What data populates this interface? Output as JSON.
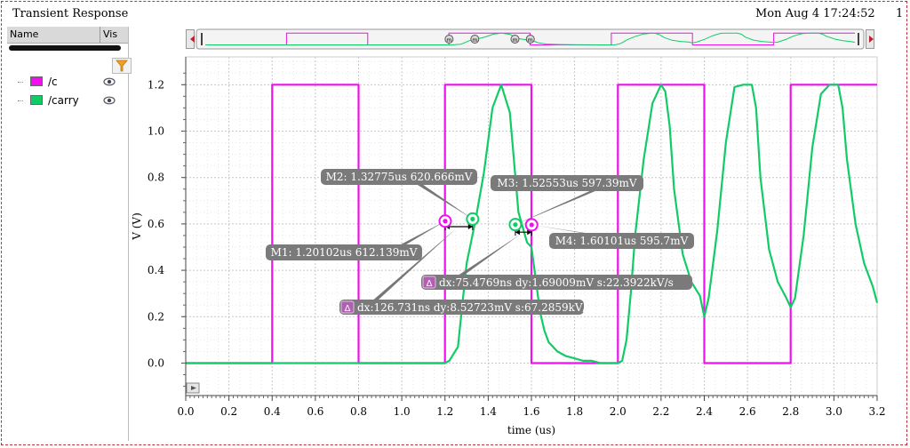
{
  "header": {
    "title": "Transient Response",
    "date": "Mon Aug 4 17:24:52",
    "page": "1"
  },
  "panel": {
    "col_name": "Name",
    "col_vis": "Vis"
  },
  "signals": [
    {
      "name": "/c",
      "color": "#ee11ee",
      "icon": "eye-icon"
    },
    {
      "name": "/carry",
      "color": "#11cc66",
      "icon": "eye-icon"
    }
  ],
  "chart_data": {
    "type": "line",
    "xlabel": "time (us)",
    "ylabel": "V (V)",
    "xlim": [
      0,
      3.2
    ],
    "ylim": [
      -0.14,
      1.32
    ],
    "xticks": [
      "0.0",
      "0.2",
      "0.4",
      "0.6",
      "0.8",
      "1.0",
      "1.2",
      "1.4",
      "1.6",
      "1.8",
      "2.0",
      "2.2",
      "2.4",
      "2.6",
      "2.8",
      "3.0",
      "3.2"
    ],
    "yticks": [
      "0.0",
      "0.2",
      "0.4",
      "0.6",
      "0.8",
      "1.0",
      "1.2"
    ],
    "grid": true,
    "series": [
      {
        "name": "/c",
        "color": "#ee11ee",
        "x": [
          0,
          0.4,
          0.4,
          0.8,
          0.8,
          1.2,
          1.2,
          1.6,
          1.6,
          2.0,
          2.0,
          2.4,
          2.4,
          2.8,
          2.8,
          3.2
        ],
        "y": [
          0,
          0,
          1.2,
          1.2,
          0,
          0,
          1.2,
          1.2,
          0,
          0,
          1.2,
          1.2,
          0,
          0,
          1.2,
          1.2
        ]
      },
      {
        "name": "/carry",
        "color": "#11cc66",
        "x": [
          0,
          1.2,
          1.22,
          1.26,
          1.3,
          1.34,
          1.38,
          1.42,
          1.46,
          1.5,
          1.54,
          1.58,
          1.6,
          1.62,
          1.64,
          1.66,
          1.68,
          1.72,
          1.76,
          1.8,
          1.84,
          1.88,
          1.92,
          1.96,
          2.0,
          2.02,
          2.04,
          2.06,
          2.08,
          2.12,
          2.16,
          2.2,
          2.22,
          2.24,
          2.26,
          2.3,
          2.34,
          2.38,
          2.4,
          2.42,
          2.46,
          2.5,
          2.54,
          2.58,
          2.62,
          2.64,
          2.66,
          2.7,
          2.74,
          2.78,
          2.8,
          2.82,
          2.86,
          2.9,
          2.94,
          2.98,
          3.02,
          3.04,
          3.06,
          3.1,
          3.14,
          3.18,
          3.2
        ],
        "y": [
          0,
          0,
          0.01,
          0.07,
          0.43,
          0.61,
          0.82,
          1.1,
          1.2,
          1.08,
          0.65,
          0.52,
          0.5,
          0.36,
          0.22,
          0.14,
          0.09,
          0.05,
          0.03,
          0.02,
          0.01,
          0.01,
          0.0,
          0.0,
          0.0,
          0.01,
          0.1,
          0.3,
          0.55,
          0.88,
          1.12,
          1.2,
          1.17,
          1.02,
          0.75,
          0.47,
          0.35,
          0.29,
          0.2,
          0.28,
          0.57,
          0.95,
          1.19,
          1.2,
          1.2,
          1.1,
          0.8,
          0.49,
          0.35,
          0.28,
          0.24,
          0.28,
          0.55,
          0.93,
          1.16,
          1.2,
          1.2,
          1.1,
          0.88,
          0.6,
          0.43,
          0.33,
          0.26
        ]
      }
    ],
    "markers": [
      {
        "label": "M1: 1.20102us 612.139mV",
        "x": 1.20102,
        "y": 0.612,
        "color": "#ee11ee"
      },
      {
        "label": "M2: 1.32775us 620.666mV",
        "x": 1.32775,
        "y": 0.621,
        "color": "#11cc66"
      },
      {
        "label": "M3: 1.52553us 597.39mV",
        "x": 1.52553,
        "y": 0.597,
        "color": "#11cc66"
      },
      {
        "label": "M4: 1.60101us 595.7mV",
        "x": 1.60101,
        "y": 0.596,
        "color": "#ee11ee"
      }
    ],
    "deltas": [
      {
        "label": "dx:75.4769ns dy:1.69009mV s:22.3922kV/s",
        "from": 2,
        "to": 3
      },
      {
        "label": "dx:126.731ns dy:8.52723mV s:67.2859kV/s",
        "from": 0,
        "to": 1
      }
    ]
  }
}
